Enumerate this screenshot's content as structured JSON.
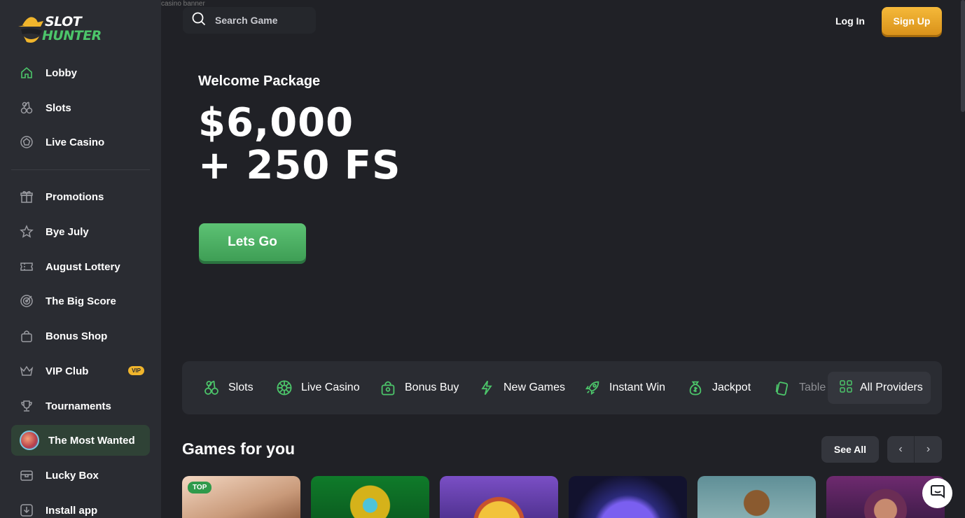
{
  "brand": {
    "line1": "SLOT",
    "line2": "HUNTER",
    "accent": "#4cc56a"
  },
  "header": {
    "broken_image_alt": "casino banner",
    "search_placeholder": "Search Game",
    "login_label": "Log In",
    "signup_label": "Sign Up"
  },
  "sidebar": {
    "items": [
      {
        "label": "Lobby",
        "icon": "home-icon"
      },
      {
        "label": "Slots",
        "icon": "cherries-icon"
      },
      {
        "label": "Live Casino",
        "icon": "roulette-icon"
      },
      {
        "label": "Promotions",
        "icon": "gift-icon"
      },
      {
        "label": "Bye July",
        "icon": "star-icon"
      },
      {
        "label": "August Lottery",
        "icon": "ticket-icon"
      },
      {
        "label": "The Big Score",
        "icon": "target-icon"
      },
      {
        "label": "Bonus Shop",
        "icon": "shopping-bag-icon"
      },
      {
        "label": "VIP Club",
        "icon": "crown-icon",
        "badge": "VIP"
      },
      {
        "label": "Tournaments",
        "icon": "trophy-icon"
      },
      {
        "label": "The Most Wanted",
        "icon": "avatar",
        "active": true
      },
      {
        "label": "Lucky Box",
        "icon": "box-icon"
      },
      {
        "label": "Install app",
        "icon": "download-icon"
      }
    ]
  },
  "hero": {
    "subtitle": "Welcome Package",
    "amount_line1": "$6,000",
    "amount_line2": "+ 250 FS",
    "cta_label": "Lets Go"
  },
  "categories": {
    "items": [
      {
        "label": "Slots",
        "icon": "cherries-icon"
      },
      {
        "label": "Live Casino",
        "icon": "roulette-icon"
      },
      {
        "label": "Bonus Buy",
        "icon": "shopping-bag-icon"
      },
      {
        "label": "New Games",
        "icon": "lightning-icon"
      },
      {
        "label": "Instant Win",
        "icon": "rocket-icon"
      },
      {
        "label": "Jackpot",
        "icon": "money-bag-icon"
      },
      {
        "label": "Table",
        "icon": "cards-icon"
      }
    ],
    "all_providers_label": "All Providers"
  },
  "games_section": {
    "title": "Games for you",
    "see_all_label": "See All",
    "first_tile_badge": "TOP"
  }
}
